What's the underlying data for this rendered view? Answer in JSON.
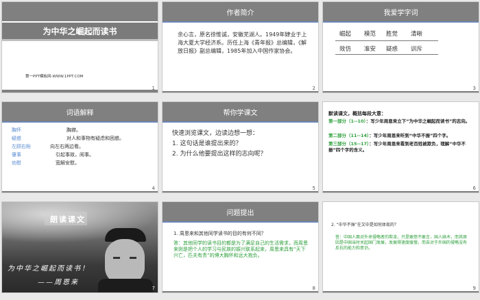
{
  "slides": [
    {
      "num": "1",
      "title": "为中华之崛起而读书",
      "footer": "第一PPT模板网-WWW.1PPT.COM"
    },
    {
      "num": "2",
      "title": "作者简介",
      "body": "余心言，原名徐惟诚，安徽芜湖人。1949年肄业于上海大夏大学经济系。历任上海《青年报》总编辑，《解放日报》副总编辑，1985年加入中国作家协会。"
    },
    {
      "num": "3",
      "title": "我爱学字词",
      "words": [
        "崛起",
        "模范",
        "胜觉",
        "清晰",
        "效仿",
        "准安",
        "疑惑",
        "训斥"
      ]
    },
    {
      "num": "4",
      "title": "词语解释",
      "rows": [
        {
          "term": "胸怀",
          "def": "胸襟。"
        },
        {
          "term": "疑惑",
          "def": "对人和事物有疑虑和困惑。"
        },
        {
          "term": "左顾右盼",
          "def": "向左右两边看。"
        },
        {
          "term": "肇事",
          "def": "引起事故，闹事。"
        },
        {
          "term": "劝慰",
          "def": "宽解安慰。"
        }
      ]
    },
    {
      "num": "5",
      "title": "帮你学课文",
      "lines": [
        "快速浏览课文，边读边想一想：",
        "1. 这句话是谁提出来的？",
        "2. 为什么他要提出这样的志向呢？"
      ]
    },
    {
      "num": "6",
      "heading": "默读课文，概括每段大意：",
      "parts": [
        {
          "label": "第一部分（1--10）",
          "text": "：写少年周恩来立下“为中华之崛起而读书”的志向。"
        },
        {
          "label": "第二部分（11--14）",
          "text": "：写少年周恩来听到“中华不振”四个字。"
        },
        {
          "label": "第三部分（15--17）",
          "text": "：写少年周恩来看到老百姓被欺负，理解“中华不振”四个字的含义。"
        }
      ]
    },
    {
      "num": "7",
      "tag": "朗读课文",
      "cal1": "为中华之崛起而读书！",
      "cal2": "——周恩来"
    },
    {
      "num": "8",
      "title": "问题提出",
      "question": "1. 周恩来和其他同学读书的目的有何不同？",
      "answer": "答：其他同学的读书目的都是为了满足自己的生活需求，而周恩来则是把个人的学习与民族的振兴联系起来，周恩来具有“天下兴亡，匹夫有责”的博大胸怀和远大抱负。"
    },
    {
      "num": "9",
      "question": "2. “中华不振”在文中是如何体现的？",
      "answer": "答：中国人面对外来侵略者的欺凌，只是敢怒不敢言，国人麻木，而其原因是中国当时关起国门发展，发展得速度缓慢，而自对于外国的侵略没有反抗的能力和意识。"
    }
  ],
  "colors": {
    "header_gray": "#808080",
    "accent_blue": "#6b86b8",
    "term_blue": "#5b8bd0",
    "answer_green": "#2b9e3a"
  }
}
